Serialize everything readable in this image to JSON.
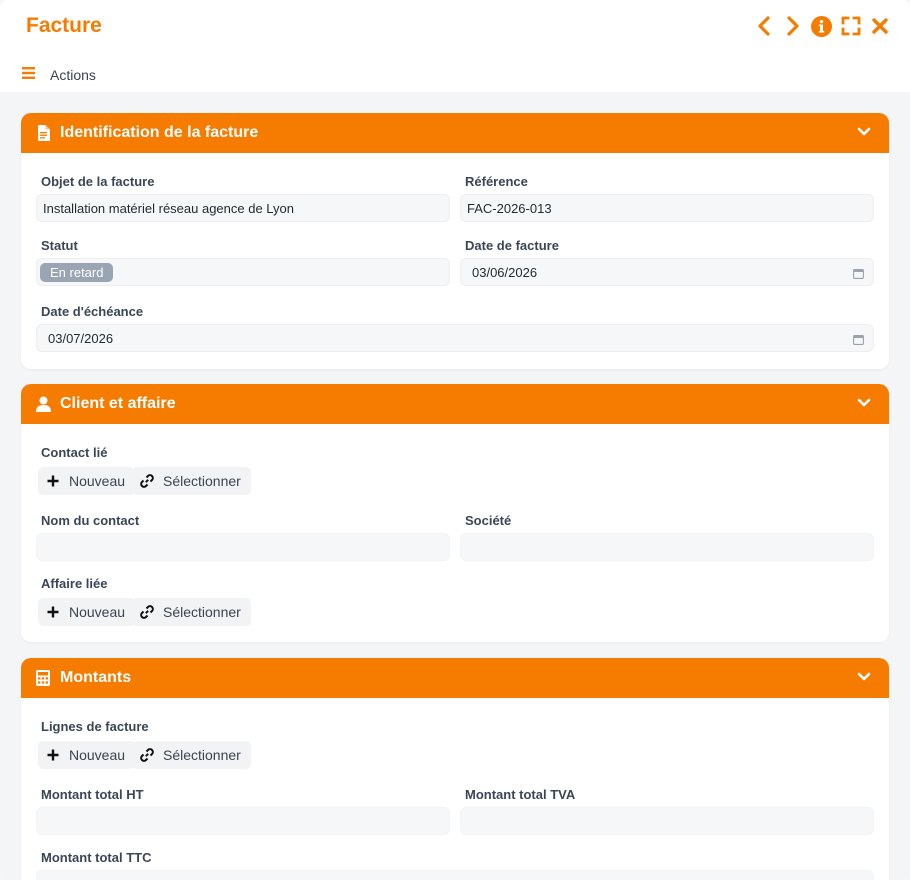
{
  "window": {
    "title": "Facture",
    "actions_label": "Actions"
  },
  "colors": {
    "accent": "#f57c00",
    "badge": "#9aa5b4"
  },
  "icons": {
    "prev": "chevron-left-icon",
    "next": "chevron-right-icon",
    "info": "info-icon",
    "expand": "expand-icon",
    "close": "close-icon",
    "menu": "hamburger-icon"
  },
  "sections": {
    "identification": {
      "title": "Identification de la facture",
      "objet_label": "Objet de la facture",
      "objet_value": "Installation matériel réseau agence de Lyon",
      "reference_label": "Référence",
      "reference_value": "FAC-2026-013",
      "statut_label": "Statut",
      "statut_value": "En retard",
      "date_facture_label": "Date de facture",
      "date_facture_value": "03/06/2026",
      "date_echeance_label": "Date d'échéance",
      "date_echeance_value": "03/07/2026"
    },
    "client": {
      "title": "Client et affaire",
      "contact_label": "Contact lié",
      "new_label": "Nouveau",
      "select_label": "Sélectionner",
      "nom_contact_label": "Nom du contact",
      "nom_contact_value": "",
      "societe_label": "Société",
      "societe_value": "",
      "affaire_label": "Affaire liée"
    },
    "montants": {
      "title": "Montants",
      "lignes_label": "Lignes de facture",
      "new_label": "Nouveau",
      "select_label": "Sélectionner",
      "ht_label": "Montant total HT",
      "ht_value": "",
      "tva_label": "Montant total TVA",
      "tva_value": "",
      "ttc_label": "Montant total TTC",
      "ttc_value": ""
    }
  }
}
